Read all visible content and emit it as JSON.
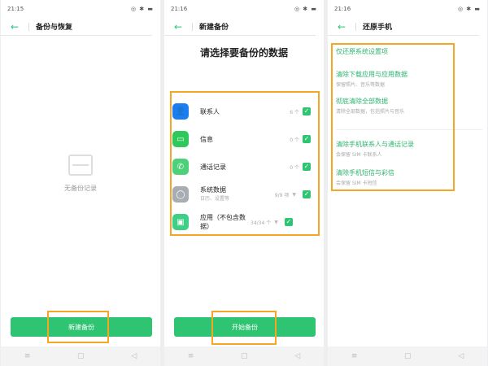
{
  "panels": [
    {
      "time": "21:15",
      "title": "备份与恢复",
      "empty_text": "无备份记录",
      "button": "新建备份"
    },
    {
      "time": "21:16",
      "title": "新建备份",
      "heading": "请选择要备份的数据",
      "button": "开始备份",
      "items": [
        {
          "label": "联系人",
          "count": "6 个"
        },
        {
          "label": "信息",
          "count": "0 个"
        },
        {
          "label": "通话记录",
          "count": "0 个"
        },
        {
          "label": "系统数据",
          "sub": "日历、设置等",
          "count": "9/9 项"
        },
        {
          "label": "应用（不包含数据）",
          "count": "34/34 个"
        }
      ]
    },
    {
      "time": "21:16",
      "title": "还原手机",
      "options": [
        {
          "title": "仅还原系统设置项"
        },
        {
          "title": "清除下载应用与应用数据",
          "sub": "保留照片、音乐等数据"
        },
        {
          "title": "彻底清除全部数据",
          "sub": "清除全部数据，包括照片与音乐"
        },
        {
          "title": "清除手机联系人与通话记录",
          "sub": "会保留 SIM 卡联系人"
        },
        {
          "title": "清除手机短信与彩信",
          "sub": "会保留 SIM 卡短信"
        }
      ]
    }
  ],
  "status_signal": "▂▄▆ ≡",
  "status_right": "◎ ✱ ▬",
  "nav": {
    "menu": "≡",
    "home": "▢",
    "back": "◁"
  },
  "colors": {
    "accent": "#2fc472",
    "highlight": "#f5a623"
  }
}
